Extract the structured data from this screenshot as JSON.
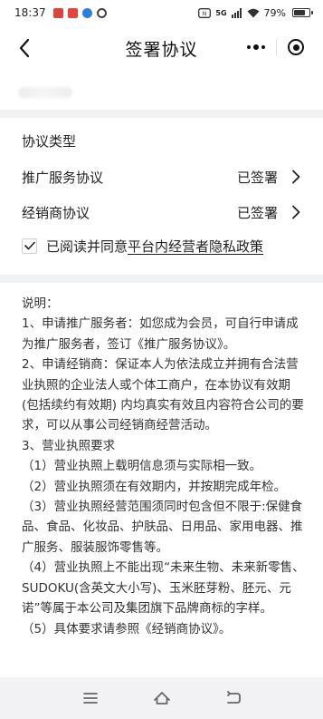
{
  "status_bar": {
    "time": "18:37",
    "signal_badge": "5G",
    "battery_text": "79%",
    "battery_level": 0.79,
    "app_icons": [
      {
        "icon": "red-app-icon",
        "color": "#d9463b"
      },
      {
        "icon": "red-app-icon-2",
        "color": "#e2463c"
      },
      {
        "icon": "blue-app-icon",
        "color": "#2f7de1"
      },
      {
        "icon": "leaf-app-icon",
        "color": "#444444"
      }
    ]
  },
  "nav": {
    "title": "签署协议",
    "back_icon": "chevron-left-icon",
    "more_icon": "more-dots-icon",
    "close_icon": "target-icon"
  },
  "agreements": {
    "section_title": "协议类型",
    "items": [
      {
        "label": "推广服务协议",
        "status": "已签署"
      },
      {
        "label": "经销商协议",
        "status": "已签署"
      }
    ]
  },
  "consent": {
    "checked": true,
    "prefix": "已阅读并同意",
    "link": "平台内经营者隐私政策"
  },
  "notes": {
    "lines": [
      "说明：",
      "1、申请推广服务者：如您成为会员，可自行申请成为推广服务者，签订《推广服务协议》。",
      "2、申请经销商：保证本人为依法成立并拥有合法营业执照的企业法人或个体工商户，在本协议有效期 (包括续约有效期) 内均真实有效且内容符合公司的要求，可以从事公司经销商经营活动。",
      "3、营业执照要求",
      "（1）营业执照上载明信息须与实际相一致。",
      "（2）营业执照须在有效期内，并按期完成年检。",
      "（3）营业执照经营范围须同时包含但不限于:保健食品、食品、化妆品、护肤品、日用品、家用电器、推广服务、服装服饰零售等。",
      "（4）营业执照上不能出现“未来生物、未来新零售、SUDOKU(含英文大小写)、玉米胚芽粉、胚元、元诺”等属于本公司及集团旗下品牌商标的字样。",
      "（5）具体要求请参照《经销商协议》。"
    ]
  },
  "system_nav": {
    "menu_icon": "menu-lines-icon",
    "home_icon": "home-icon",
    "back_icon": "system-back-icon"
  },
  "colors": {
    "divider_band": "#f1f2f4",
    "text_primary": "#222222",
    "text_notes": "#333333",
    "system_nav_bg": "#f2f2f4"
  }
}
